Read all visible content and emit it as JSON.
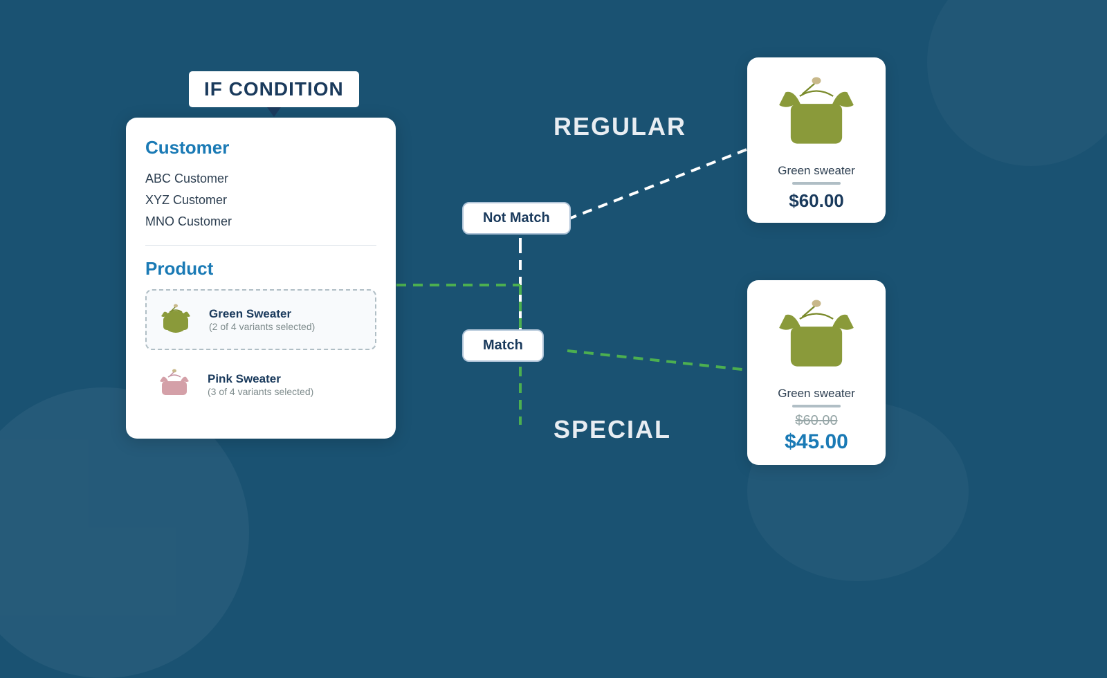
{
  "condition_label": "IF CONDITION",
  "card": {
    "customer_section_title": "Customer",
    "customers": [
      {
        "name": "ABC Customer",
        "selected": false
      },
      {
        "name": "XYZ Customer",
        "selected": true
      },
      {
        "name": "MNO Customer",
        "selected": false
      }
    ],
    "product_section_title": "Product",
    "products": [
      {
        "name": "Green Sweater",
        "variants": "(2 of 4 variants selected)",
        "color": "green",
        "selected": true
      },
      {
        "name": "Pink Sweater",
        "variants": "(3 of 4 variants selected)",
        "color": "pink",
        "selected": false
      }
    ]
  },
  "flow": {
    "not_match_label": "Not Match",
    "match_label": "Match",
    "regular_label": "REGULAR",
    "special_label": "SPECIAL"
  },
  "result_regular": {
    "product_name": "Green sweater",
    "price": "$60.00"
  },
  "result_special": {
    "product_name": "Green sweater",
    "price_original": "$60.00",
    "price_special": "$45.00"
  }
}
